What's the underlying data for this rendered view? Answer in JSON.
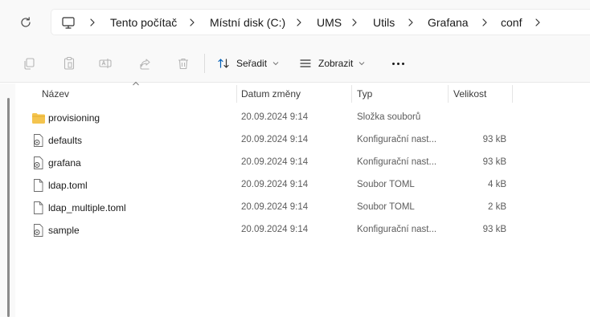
{
  "address": {
    "breadcrumbs": [
      "Tento počítač",
      "Místní disk (C:)",
      "UMS",
      "Utils",
      "Grafana",
      "conf"
    ]
  },
  "toolbar": {
    "sort_label": "Seřadit",
    "view_label": "Zobrazit",
    "icons": [
      "copy-icon",
      "paste-icon",
      "rename-icon",
      "share-icon",
      "delete-icon",
      "more-icon"
    ]
  },
  "columns": {
    "name": "Název",
    "date": "Datum změny",
    "type": "Typ",
    "size": "Velikost"
  },
  "files": [
    {
      "name": "provisioning",
      "date": "20.09.2024 9:14",
      "type": "Složka souborů",
      "size": "",
      "icon": "folder-icon"
    },
    {
      "name": "defaults",
      "date": "20.09.2024 9:14",
      "type": "Konfigurační nast...",
      "size": "93 kB",
      "icon": "config-file-icon"
    },
    {
      "name": "grafana",
      "date": "20.09.2024 9:14",
      "type": "Konfigurační nast...",
      "size": "93 kB",
      "icon": "config-file-icon"
    },
    {
      "name": "ldap.toml",
      "date": "20.09.2024 9:14",
      "type": "Soubor TOML",
      "size": "4 kB",
      "icon": "file-icon"
    },
    {
      "name": "ldap_multiple.toml",
      "date": "20.09.2024 9:14",
      "type": "Soubor TOML",
      "size": "2 kB",
      "icon": "file-icon"
    },
    {
      "name": "sample",
      "date": "20.09.2024 9:14",
      "type": "Konfigurační nast...",
      "size": "93 kB",
      "icon": "config-file-icon"
    }
  ],
  "colors": {
    "folder": "#f4c44e",
    "window_bg": "#f9f9f9",
    "accent": "#005fb8"
  }
}
